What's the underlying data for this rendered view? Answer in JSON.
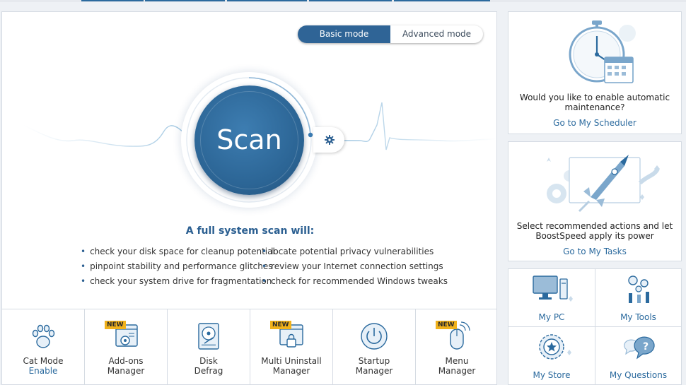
{
  "mode_toggle": {
    "basic": "Basic mode",
    "advanced": "Advanced mode",
    "active": "basic"
  },
  "scan": {
    "button_label": "Scan",
    "title": "A full system scan will:",
    "left_items": [
      "check your disk space for cleanup potential",
      "pinpoint stability and performance glitches",
      "check your system drive for fragmentation"
    ],
    "right_items": [
      "locate potential privacy vulnerabilities",
      "review your Internet connection settings",
      "check for recommended Windows tweaks"
    ]
  },
  "tools": [
    {
      "title": "Cat Mode",
      "subtitle": "Enable",
      "icon": "paw-icon",
      "badge": ""
    },
    {
      "title": "Add-ons",
      "subtitle": "Manager",
      "icon": "addons-gear-icon",
      "badge": "NEW"
    },
    {
      "title": "Disk",
      "subtitle": "Defrag",
      "icon": "disk-icon",
      "badge": ""
    },
    {
      "title": "Multi Uninstall",
      "subtitle": "Manager",
      "icon": "lock-window-icon",
      "badge": "NEW"
    },
    {
      "title": "Startup",
      "subtitle": "Manager",
      "icon": "power-icon",
      "badge": ""
    },
    {
      "title": "Menu",
      "subtitle": "Manager",
      "icon": "mouse-icon",
      "badge": "NEW"
    }
  ],
  "scheduler_card": {
    "text_line1": "Would you like to enable automatic",
    "text_line2": "maintenance?",
    "link": "Go to My Scheduler"
  },
  "tasks_card": {
    "text_line1": "Select recommended actions and let",
    "text_line2": "BoostSpeed apply its power",
    "link": "Go to My Tasks"
  },
  "quick_links": [
    {
      "label": "My PC",
      "icon": "computer-icon"
    },
    {
      "label": "My Tools",
      "icon": "tools-icon"
    },
    {
      "label": "My Store",
      "icon": "store-gear-icon"
    },
    {
      "label": "My Questions",
      "icon": "question-bubble-icon"
    }
  ],
  "colors": {
    "accent": "#2f6496",
    "link": "#2b6a9e",
    "badge": "#f1b21b"
  }
}
